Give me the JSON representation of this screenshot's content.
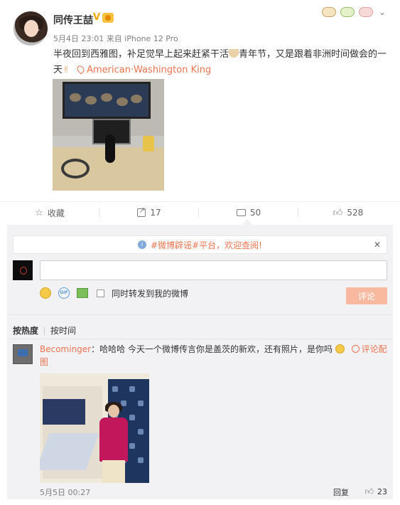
{
  "post": {
    "username": "同传王喆",
    "verified_mark": "V",
    "meta": "5月4日 23:01 来自 iPhone 12 Pro",
    "text_before": "半夜回到西雅图，补足觉早上起来赶紧干活",
    "text_after": "青年节，又是跟着非洲时间做会的一天",
    "location": "American·Washington King"
  },
  "actions": {
    "favorite": "收藏",
    "repost_count": "17",
    "comment_count": "50",
    "like_count": "528"
  },
  "comments": {
    "notice_prefix": "#微博辟谣#平台，",
    "notice_link": "欢迎查阅!",
    "close": "✕",
    "input_placeholder": "",
    "repost_label": "同时转发到我的微博",
    "submit_label": "评论",
    "sort_hot": "按热度",
    "sort_time": "按时间",
    "items": [
      {
        "user": "Becominger",
        "text": "：哈哈哈 今天一个微博传言你是盖茨的新欢，还有照片，是你吗",
        "image_link": "评论配图",
        "time": "5月5日 00:27",
        "reply": "回复",
        "likes": "23"
      }
    ]
  },
  "colors": {
    "accent": "#eb7350",
    "submit_disabled": "#f9b9a0",
    "panel_bg": "#f2f2f5"
  },
  "icons": [
    "star-icon",
    "repost-icon",
    "comment-icon",
    "like-icon",
    "emoji-icon",
    "gif-icon",
    "image-icon",
    "location-pin-icon",
    "info-icon",
    "close-icon",
    "chevron-down-icon"
  ]
}
